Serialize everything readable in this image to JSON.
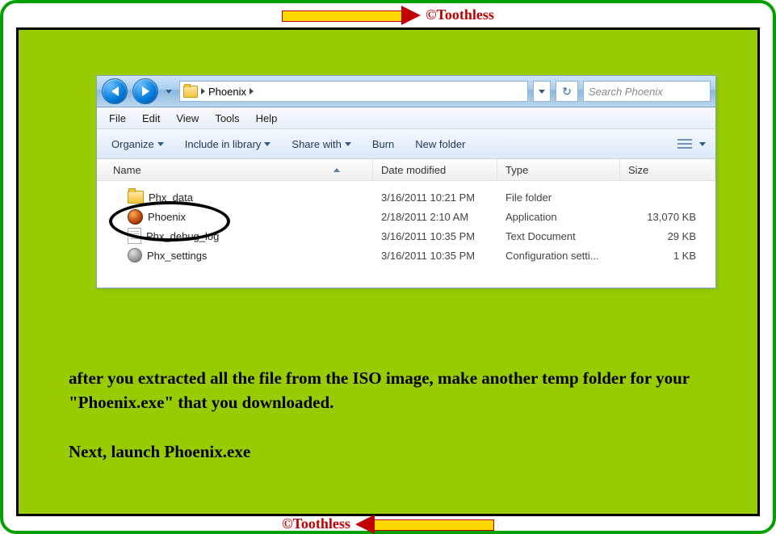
{
  "watermark": "©Toothless",
  "nav": {
    "folder_name": "Phoenix",
    "search_placeholder": "Search Phoenix"
  },
  "menus": {
    "file": "File",
    "edit": "Edit",
    "view": "View",
    "tools": "Tools",
    "help": "Help"
  },
  "toolbar": {
    "organize": "Organize",
    "include": "Include in library",
    "share": "Share with",
    "burn": "Burn",
    "newfolder": "New folder"
  },
  "columns": {
    "name": "Name",
    "date": "Date modified",
    "type": "Type",
    "size": "Size"
  },
  "files": [
    {
      "name": "Phx_data",
      "date": "3/16/2011 10:21 PM",
      "type": "File folder",
      "size": "",
      "icon": "folder"
    },
    {
      "name": "Phoenix",
      "date": "2/18/2011 2:10 AM",
      "type": "Application",
      "size": "13,070 KB",
      "icon": "app"
    },
    {
      "name": "Phx_debug_log",
      "date": "3/16/2011 10:35 PM",
      "type": "Text Document",
      "size": "29 KB",
      "icon": "txt"
    },
    {
      "name": "Phx_settings",
      "date": "3/16/2011 10:35 PM",
      "type": "Configuration setti...",
      "size": "1 KB",
      "icon": "cfg"
    }
  ],
  "instructions": {
    "p1": "after you extracted all the file from the ISO image, make another temp folder for your \"Phoenix.exe\" that you downloaded.",
    "p2": "Next, launch Phoenix.exe"
  }
}
